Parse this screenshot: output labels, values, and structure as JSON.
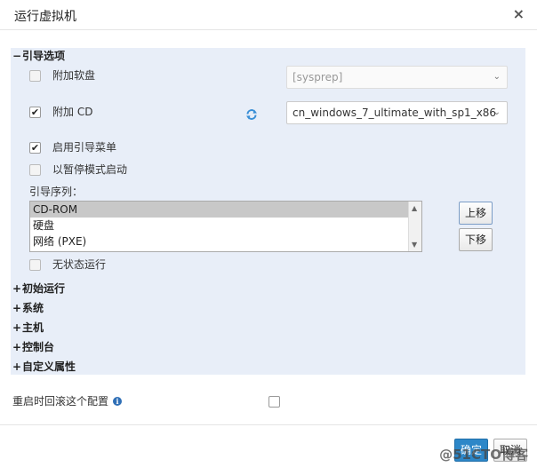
{
  "dialog": {
    "title": "运行虚拟机",
    "close_label": "×"
  },
  "boot_options": {
    "header": "引导选项",
    "header_sign": "−",
    "attach_floppy": {
      "label": "附加软盘",
      "checked": false
    },
    "floppy_select": {
      "value": "[sysprep]"
    },
    "attach_cd": {
      "label": "附加 CD",
      "checked": true
    },
    "cd_select": {
      "value": "cn_windows_7_ultimate_with_sp1_x86"
    },
    "boot_menu": {
      "label": "启用引导菜单",
      "checked": true
    },
    "paused_mode": {
      "label": "以暂停模式启动",
      "checked": false
    },
    "boot_sequence_label": "引导序列：",
    "boot_sequence": [
      "CD-ROM",
      "硬盘",
      "网络 (PXE)"
    ],
    "move_up_label": "上移",
    "move_down_label": "下移",
    "stateless": {
      "label": "无状态运行",
      "checked": false
    }
  },
  "sections": [
    {
      "label": "初始运行",
      "sign": "+"
    },
    {
      "label": "系统",
      "sign": "+"
    },
    {
      "label": "主机",
      "sign": "+"
    },
    {
      "label": "控制台",
      "sign": "+"
    },
    {
      "label": "自定义属性",
      "sign": "+"
    }
  ],
  "rollback": {
    "label": "重启时回滚这个配置",
    "checked": false
  },
  "footer": {
    "ok_label": "确定",
    "cancel_label": "取消",
    "watermark": "@51CTO博客"
  },
  "colors": {
    "panel_bg": "#e8eef8",
    "primary": "#2d87c8"
  }
}
